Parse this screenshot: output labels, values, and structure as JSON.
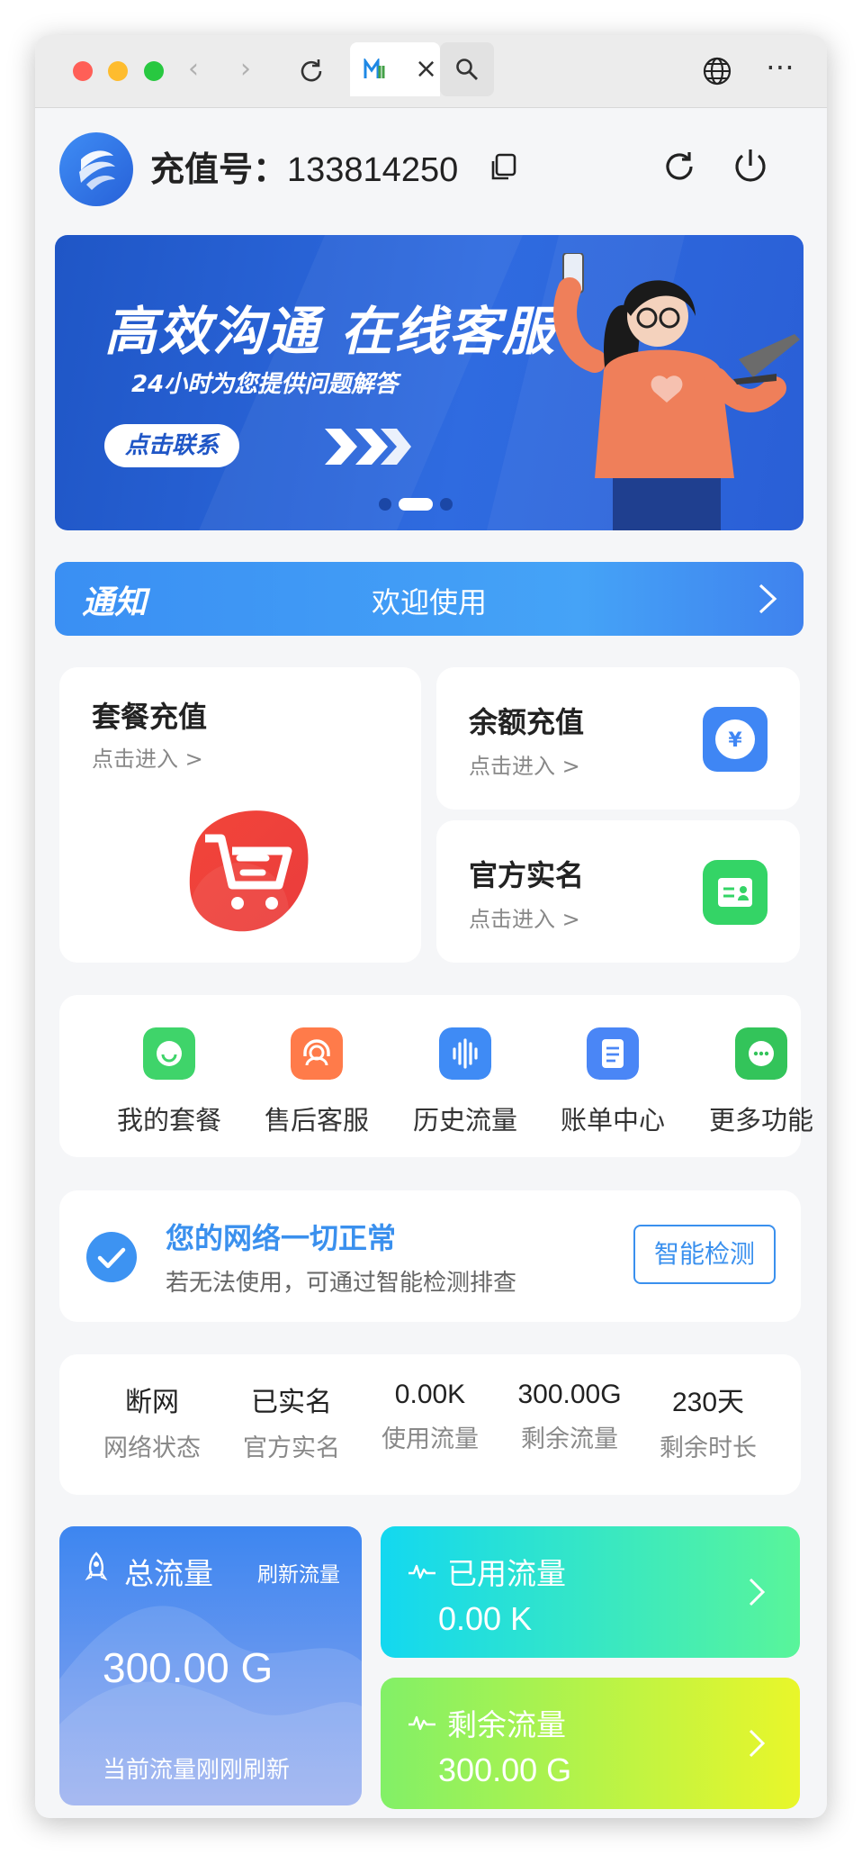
{
  "app": {
    "account_label": "充值号：",
    "account_number": "133814250"
  },
  "banner": {
    "title": "高效沟通 在线客服",
    "subtitle": "24小时为您提供问题解答",
    "button": "点击联系"
  },
  "notice": {
    "tag": "通知",
    "text": "欢迎使用"
  },
  "cards": {
    "package": {
      "title": "套餐充值",
      "sub": "点击进入 >"
    },
    "balance": {
      "title": "余额充值",
      "sub": "点击进入 >"
    },
    "realname": {
      "title": "官方实名",
      "sub": "点击进入 >"
    }
  },
  "quick_actions": [
    {
      "label": "我的套餐",
      "icon": "smile-icon",
      "color": "#3fd46a"
    },
    {
      "label": "售后客服",
      "icon": "headset-icon",
      "color": "#ff7b4a"
    },
    {
      "label": "历史流量",
      "icon": "waveform-icon",
      "color": "#3f8bf5"
    },
    {
      "label": "账单中心",
      "icon": "bill-icon",
      "color": "#4a86f6"
    },
    {
      "label": "更多功能",
      "icon": "more-icon",
      "color": "#33c45a"
    }
  ],
  "network": {
    "title": "您的网络一切正常",
    "sub": "若无法使用，可通过智能检测排查",
    "button": "智能检测"
  },
  "stats": [
    {
      "value": "断网",
      "label": "网络状态"
    },
    {
      "value": "已实名",
      "label": "官方实名"
    },
    {
      "value": "0.00K",
      "label": "使用流量"
    },
    {
      "value": "300.00G",
      "label": "剩余流量"
    },
    {
      "value": "230天",
      "label": "剩余时长"
    }
  ],
  "total": {
    "title": "总流量",
    "refresh": "刷新流量",
    "value": "300.00 G",
    "footer": "当前流量刚刚刷新"
  },
  "used": {
    "title": "已用流量",
    "value": "0.00 K"
  },
  "remaining": {
    "title": "剩余流量",
    "value": "300.00 G"
  }
}
